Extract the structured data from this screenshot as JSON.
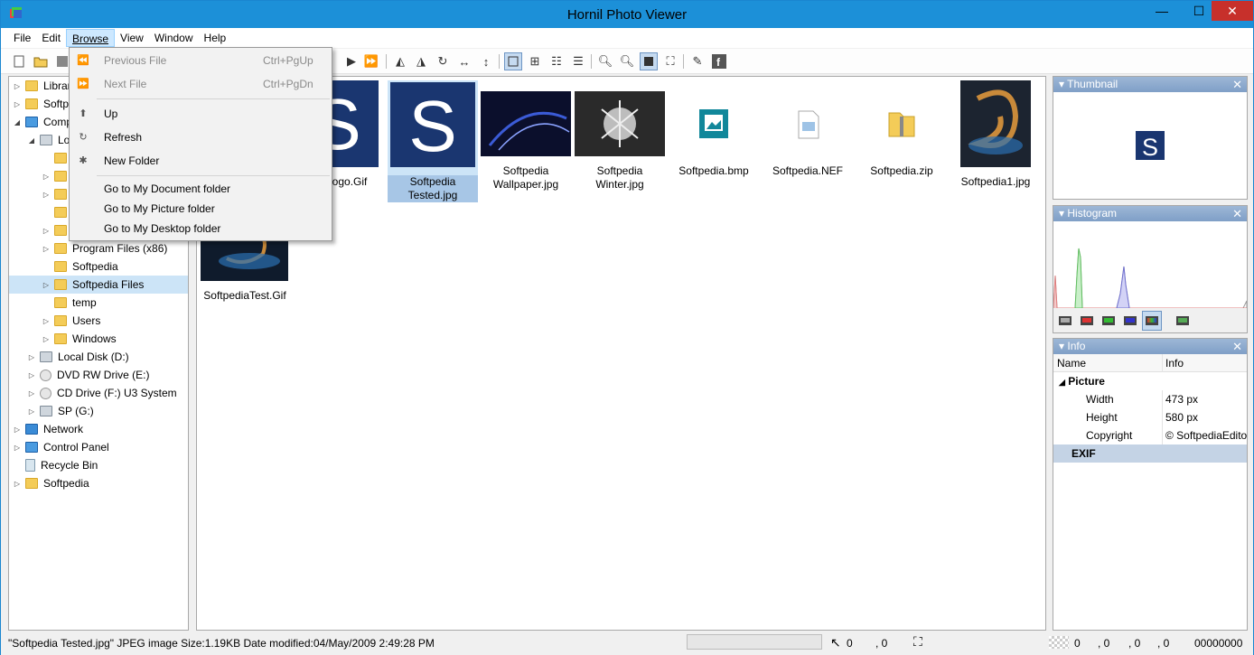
{
  "app": {
    "title": "Hornil Photo Viewer"
  },
  "window_buttons": {
    "minimize": "—",
    "maximize": "☐",
    "close": "✕"
  },
  "menubar": [
    "File",
    "Edit",
    "Browse",
    "View",
    "Window",
    "Help"
  ],
  "browse_menu": {
    "items": [
      {
        "label": "Previous File",
        "shortcut": "Ctrl+PgUp",
        "icon": "previous-icon",
        "disabled": true
      },
      {
        "label": "Next File",
        "shortcut": "Ctrl+PgDn",
        "icon": "next-icon",
        "disabled": true
      },
      {
        "label": "Up",
        "shortcut": "",
        "icon": "folder-up-icon",
        "disabled": false
      },
      {
        "label": "Refresh",
        "shortcut": "",
        "icon": "refresh-icon",
        "disabled": false
      },
      {
        "label": "New Folder",
        "shortcut": "",
        "icon": "new-folder-icon",
        "disabled": false
      },
      {
        "label": "Go to My Document folder",
        "shortcut": "",
        "icon": "",
        "disabled": false
      },
      {
        "label": "Go to My Picture folder",
        "shortcut": "",
        "icon": "",
        "disabled": false
      },
      {
        "label": "Go to My Desktop folder",
        "shortcut": "",
        "icon": "",
        "disabled": false
      }
    ]
  },
  "tree": {
    "items": [
      {
        "label": "Librar",
        "icon": "libraries-icon",
        "level": 0,
        "arrow": "▷"
      },
      {
        "label": "Softp",
        "icon": "user-folder-icon",
        "level": 0,
        "arrow": "▷"
      },
      {
        "label": "Comp",
        "icon": "computer-icon",
        "level": 0,
        "arrow": "◢"
      },
      {
        "label": "Lo",
        "icon": "drive-icon",
        "level": 1,
        "arrow": "◢"
      },
      {
        "label": "",
        "icon": "folder-icon",
        "level": 2,
        "arrow": ""
      },
      {
        "label": "",
        "icon": "folder-icon",
        "level": 2,
        "arrow": "▷"
      },
      {
        "label": "",
        "icon": "folder-icon",
        "level": 2,
        "arrow": "▷"
      },
      {
        "label": "",
        "icon": "folder-icon",
        "level": 2,
        "arrow": ""
      },
      {
        "label": "",
        "icon": "folder-icon",
        "level": 2,
        "arrow": "▷"
      },
      {
        "label": "Program Files (x86)",
        "icon": "folder-icon",
        "level": 2,
        "arrow": "▷"
      },
      {
        "label": "Softpedia",
        "icon": "folder-icon",
        "level": 2,
        "arrow": ""
      },
      {
        "label": "Softpedia Files",
        "icon": "folder-icon",
        "level": 2,
        "arrow": "▷",
        "selected": true
      },
      {
        "label": "temp",
        "icon": "folder-icon",
        "level": 2,
        "arrow": ""
      },
      {
        "label": "Users",
        "icon": "folder-icon",
        "level": 2,
        "arrow": "▷"
      },
      {
        "label": "Windows",
        "icon": "folder-icon",
        "level": 2,
        "arrow": "▷"
      },
      {
        "label": "Local Disk (D:)",
        "icon": "drive-icon",
        "level": 1,
        "arrow": "▷"
      },
      {
        "label": "DVD RW Drive (E:)",
        "icon": "dvd-icon",
        "level": 1,
        "arrow": "▷"
      },
      {
        "label": "CD Drive (F:) U3 System",
        "icon": "cd-icon",
        "level": 1,
        "arrow": "▷"
      },
      {
        "label": "SP (G:)",
        "icon": "usb-drive-icon",
        "level": 1,
        "arrow": "▷"
      },
      {
        "label": "Network",
        "icon": "network-icon",
        "level": 0,
        "arrow": "▷"
      },
      {
        "label": "Control Panel",
        "icon": "control-panel-icon",
        "level": 0,
        "arrow": "▷"
      },
      {
        "label": "Recycle Bin",
        "icon": "recycle-bin-icon",
        "level": 0,
        "arrow": ""
      },
      {
        "label": "Softpedia",
        "icon": "folder-icon",
        "level": 0,
        "arrow": "▷"
      }
    ]
  },
  "thumbnails": [
    {
      "caption": "Softpedia Logo.Gif",
      "visible_caption": "a Logo.Gif",
      "kind": "logo"
    },
    {
      "caption": "Softpedia Tested.jpg",
      "kind": "logo",
      "selected": true
    },
    {
      "caption": "Softpedia Wallpaper.jpg",
      "kind": "wallpaper"
    },
    {
      "caption": "Softpedia Winter.jpg",
      "kind": "winter"
    },
    {
      "caption": "Softpedia.bmp",
      "kind": "bmp"
    },
    {
      "caption": "Softpedia.NEF",
      "kind": "nef"
    },
    {
      "caption": "Softpedia.zip",
      "kind": "zip"
    },
    {
      "caption": "Softpedia1.jpg",
      "kind": "spiral"
    },
    {
      "caption": "SoftpediaTest.Gif",
      "kind": "spiral-wide"
    }
  ],
  "panels": {
    "thumbnail": {
      "title": "Thumbnail"
    },
    "histogram": {
      "title": "Histogram"
    },
    "info": {
      "title": "Info",
      "columns": [
        "Name",
        "Info"
      ],
      "group": "Picture",
      "rows": [
        {
          "name": "Width",
          "value": "473 px"
        },
        {
          "name": "Height",
          "value": "580 px"
        },
        {
          "name": "Copyright",
          "value": "© SoftpediaEdito"
        }
      ],
      "group2": "EXIF"
    }
  },
  "status": {
    "text": "\"Softpedia Tested.jpg\" JPEG image Size:1.19KB Date modified:04/May/2009 2:49:28 PM",
    "cursor_x": "0",
    "cursor_y": ", 0",
    "color_r": "0",
    "color_g": ", 0",
    "color_b": ", 0",
    "color_a": ", 0",
    "hex": "00000000"
  },
  "colors": {
    "titlebar": "#1c90d8",
    "selection": "#cce4f7",
    "logo_blue": "#1a3670"
  }
}
